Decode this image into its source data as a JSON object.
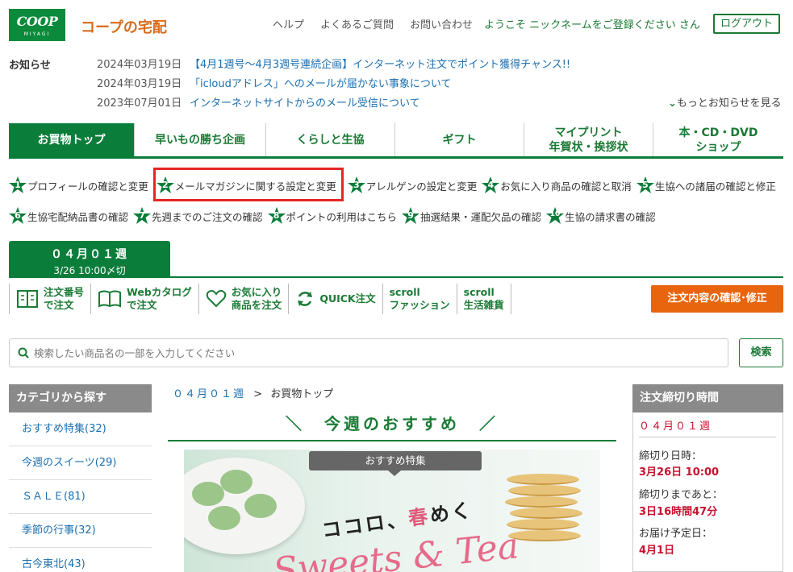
{
  "header": {
    "logo_main": "COOP",
    "logo_sub": "MIYAGI",
    "brand": "コープの宅配",
    "nav": [
      "ヘルプ",
      "よくあるご質問",
      "お問い合わせ"
    ],
    "welcome": "ようこそ ニックネームをご登録ください さん",
    "logout": "ログアウト"
  },
  "news": {
    "label": "お知らせ",
    "items": [
      {
        "date": "2024年03月19日",
        "title": "【4月1週号～4月3週号連続企画】インターネット注文でポイント獲得チャンス!!"
      },
      {
        "date": "2024年03月19日",
        "title": "「icloudアドレス」へのメールが届かない事象について"
      },
      {
        "date": "2023年07月01日",
        "title": "インターネットサイトからのメール受信について"
      }
    ],
    "more": "もっとお知らせを見る"
  },
  "mainnav": [
    {
      "label": "お買物トップ",
      "label2": ""
    },
    {
      "label": "早いもの勝ち企画",
      "label2": ""
    },
    {
      "label": "くらしと生協",
      "label2": ""
    },
    {
      "label": "ギフト",
      "label2": ""
    },
    {
      "label": "マイプリント",
      "label2": "年賀状・挨拶状"
    },
    {
      "label": "本・CD・DVD",
      "label2": "ショップ"
    }
  ],
  "steps": [
    {
      "num": "1",
      "label": "プロフィールの確認と変更"
    },
    {
      "num": "2",
      "label": "メールマガジンに関する設定と変更"
    },
    {
      "num": "3",
      "label": "アレルゲンの設定と変更"
    },
    {
      "num": "4",
      "label": "お気に入り商品の確認と取消"
    },
    {
      "num": "5",
      "label": "生協への諸届の確認と修正"
    },
    {
      "num": "6",
      "label": "生協宅配納品書の確認"
    },
    {
      "num": "7",
      "label": "先週までのご注文の確認"
    },
    {
      "num": "8",
      "label": "ポイントの利用はこちら"
    },
    {
      "num": "9",
      "label": "抽選結果・運配欠品の確認"
    },
    {
      "num": "10",
      "label": "生協の請求書の確認"
    }
  ],
  "week": {
    "title": "０４月０１週",
    "deadline": "3/26 10:00〆切"
  },
  "toolbar": [
    {
      "l1": "注文番号",
      "l2": "で注文"
    },
    {
      "l1": "Webカタログ",
      "l2": "で注文"
    },
    {
      "l1": "お気に入り",
      "l2": "商品を注文"
    },
    {
      "l1": "QUICK注文",
      "l2": ""
    },
    {
      "l1": "scroll",
      "l2": "ファッション"
    },
    {
      "l1": "scroll",
      "l2": "生活雑貨"
    }
  ],
  "order_button": "注文内容の確認･修正",
  "search": {
    "placeholder": "検索したい商品名の一部を入力してください",
    "button": "検索"
  },
  "sidebar": {
    "title": "カテゴリから探す",
    "items": [
      "おすすめ特集(32)",
      "今週のスイーツ(29)",
      "ＳＡＬＥ(81)",
      "季節の行事(32)",
      "古今東北(43)"
    ]
  },
  "breadcrumb": {
    "week": "０４月０１週",
    "sep": ">",
    "current": "お買物トップ"
  },
  "recommend": {
    "title": "＼　今週のおすすめ　／"
  },
  "banner": {
    "tag": "おすすめ特集",
    "heading_a": "ココロ、",
    "heading_spring": "春",
    "heading_b": "めく",
    "script": "Sweets & Tea"
  },
  "deadline_panel": {
    "title": "注文締切り時間",
    "week": "０４月０１週",
    "close_label": "締切り日時：",
    "close_value": "3月26日 10:00",
    "remain_label": "締切りまであと：",
    "remain_value": "3日16時間47分",
    "delivery_label": "お届け予定日：",
    "delivery_value": "4月1日"
  },
  "colors": {
    "green": "#0b7d3b",
    "orange": "#e8650e",
    "highlight": "#e52525"
  }
}
